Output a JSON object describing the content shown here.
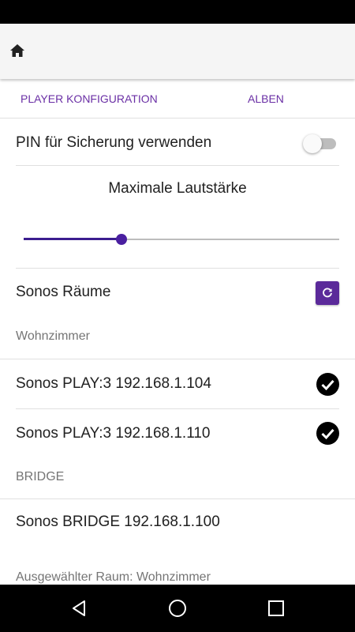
{
  "tabs": [
    {
      "label": "PLAYER KONFIGURATION"
    },
    {
      "label": "ALBEN"
    }
  ],
  "settings": {
    "pin_label": "PIN für Sicherung verwenden",
    "pin_enabled": false,
    "volume_title": "Maximale Lautstärke",
    "volume_level": 0.31
  },
  "rooms": {
    "title": "Sonos Räume",
    "groups": [
      {
        "name": "Wohnzimmer",
        "devices": [
          {
            "label": "Sonos PLAY:3 192.168.1.104",
            "selected": true
          },
          {
            "label": "Sonos PLAY:3 192.168.1.110",
            "selected": true
          }
        ]
      },
      {
        "name": "BRIDGE",
        "devices": [
          {
            "label": "Sonos BRIDGE 192.168.1.100",
            "selected": false
          }
        ]
      }
    ],
    "selected_room": "Ausgewählter Raum: Wohnzimmer"
  },
  "colors": {
    "accent": "#6a2fa5",
    "slider": "#3b1d8f",
    "button": "#5b2a9a"
  },
  "icons": {
    "home": "home-icon",
    "refresh": "refresh-icon",
    "check": "check-circle-icon",
    "back": "back-icon",
    "home_nav": "home-circle-icon",
    "recents": "recents-icon"
  }
}
